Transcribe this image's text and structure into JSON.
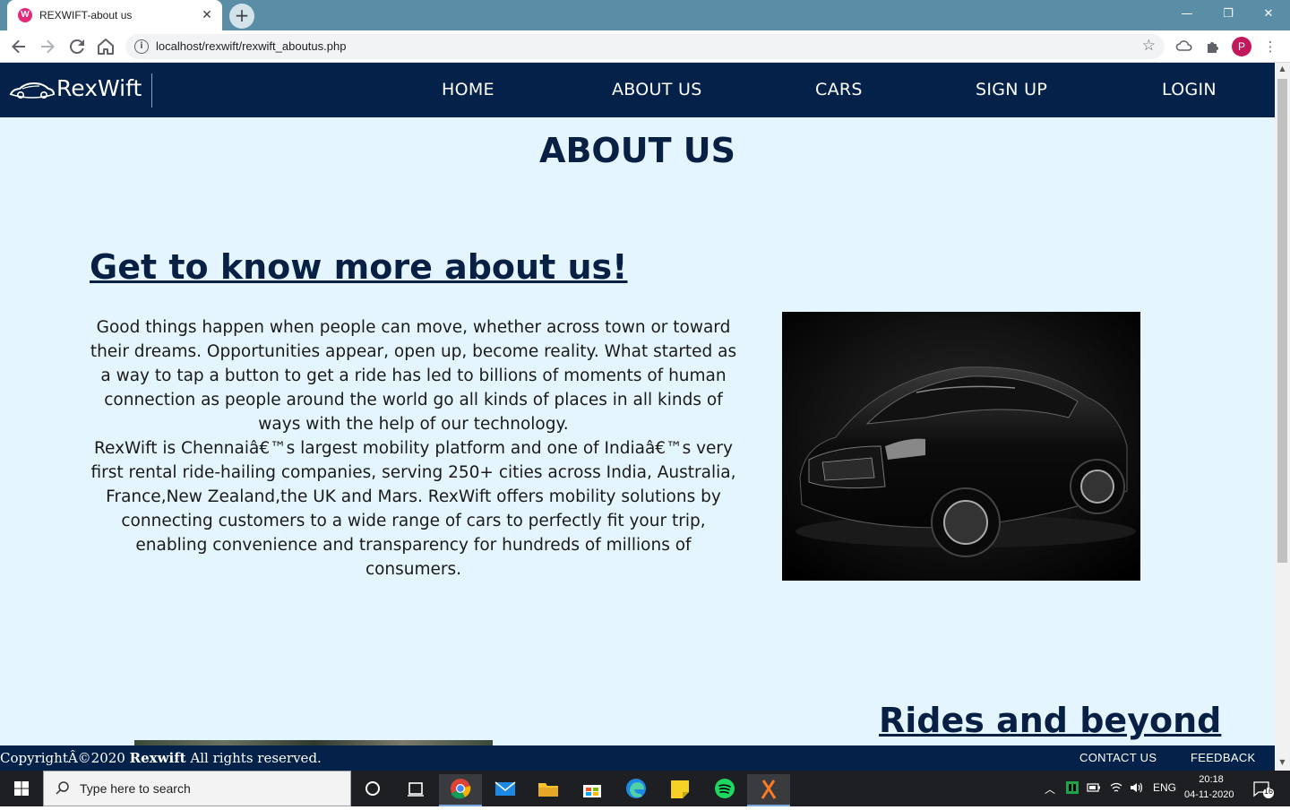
{
  "browser": {
    "tab_title": "REXWIFT-about us",
    "tab_favicon_letter": "W",
    "close_tab": "✕",
    "new_tab": "+",
    "window_controls": {
      "minimize": "—",
      "restore": "❐",
      "close": "✕"
    },
    "url": "localhost/rexwift/rexwift_aboutus.php",
    "profile_initial": "P"
  },
  "site": {
    "logo_text": "RexWift",
    "nav": [
      "HOME",
      "ABOUT US",
      "CARS",
      "SIGN UP",
      "LOGIN"
    ],
    "page_heading": "ABOUT US",
    "section_title": "Get to know more about us!",
    "paragraph_1": "Good things happen when people can move, whether across town or toward their dreams. Opportunities appear, open up, become reality. What started as a way to tap a button to get a ride has led to billions of moments of human connection as people around the world go all kinds of places in all kinds of ways with the help of our technology.",
    "paragraph_2": "RexWift is Chennaiâ€™s largest mobility platform and one of Indiaâ€™s very first rental ride-hailing companies, serving 250+ cities across India, Australia, France,New Zealand,the UK and Mars. RexWift offers mobility solutions by connecting customers to a wide range of cars to perfectly fit your trip, enabling convenience and transparency for hundreds of millions of consumers.",
    "second_section_title": "Rides and beyond",
    "footer": {
      "copyright_prefix": "CopyrightÂ©2020",
      "copyright_brand": "Rexwift",
      "copyright_suffix": "All rights reserved.",
      "links": [
        "CONTACT US",
        "FEEDBACK"
      ]
    }
  },
  "taskbar": {
    "search_placeholder": "Type here to search",
    "tray_language": "ENG",
    "time": "20:18",
    "date": "04-11-2020",
    "notification_count": "16"
  },
  "colors": {
    "nav_bg": "#042149",
    "page_bg": "#e4f5fd",
    "heading": "#082044",
    "chrome_tabbar": "#5a8ea6"
  }
}
